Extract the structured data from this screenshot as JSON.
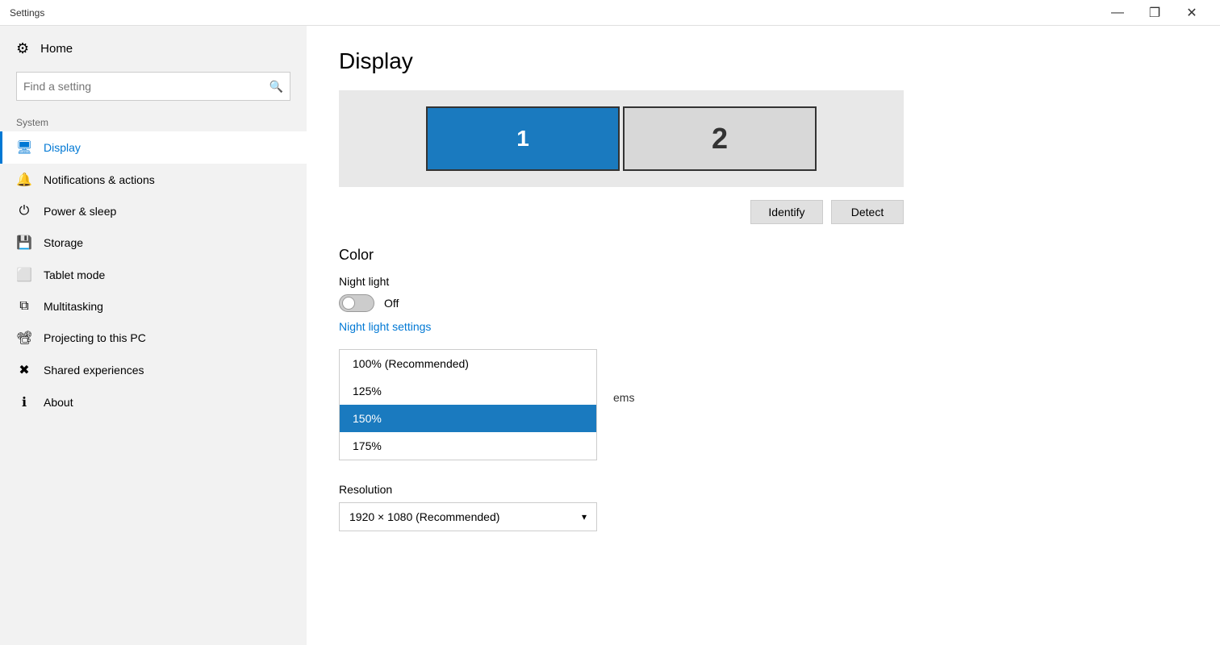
{
  "titleBar": {
    "title": "Settings",
    "minimize": "—",
    "restore": "❐",
    "close": "✕"
  },
  "sidebar": {
    "homeLabel": "Home",
    "searchPlaceholder": "Find a setting",
    "sectionLabel": "System",
    "items": [
      {
        "id": "display",
        "label": "Display",
        "icon": "🖥",
        "active": true
      },
      {
        "id": "notifications",
        "label": "Notifications & actions",
        "icon": "🔔",
        "active": false
      },
      {
        "id": "power",
        "label": "Power & sleep",
        "icon": "⏻",
        "active": false
      },
      {
        "id": "storage",
        "label": "Storage",
        "icon": "💾",
        "active": false
      },
      {
        "id": "tablet",
        "label": "Tablet mode",
        "icon": "⬜",
        "active": false
      },
      {
        "id": "multitasking",
        "label": "Multitasking",
        "icon": "⧉",
        "active": false
      },
      {
        "id": "projecting",
        "label": "Projecting to this PC",
        "icon": "📽",
        "active": false
      },
      {
        "id": "shared",
        "label": "Shared experiences",
        "icon": "✖",
        "active": false
      },
      {
        "id": "about",
        "label": "About",
        "icon": "ℹ",
        "active": false
      }
    ]
  },
  "content": {
    "pageTitle": "Display",
    "monitor1Label": "1",
    "monitor2Label": "2",
    "identifyBtn": "Identify",
    "detectBtn": "Detect",
    "colorSection": "Color",
    "nightLightLabel": "Night light",
    "nightLightState": "Off",
    "nightLightLink": "Night light settings",
    "scaleContextText": "ems",
    "dropdownOptions": [
      {
        "label": "100% (Recommended)",
        "selected": false
      },
      {
        "label": "125%",
        "selected": false
      },
      {
        "label": "150%",
        "selected": true
      },
      {
        "label": "175%",
        "selected": false
      }
    ],
    "resolutionLabel": "Resolution",
    "resolutionValue": "1920 × 1080 (Recommended)"
  }
}
